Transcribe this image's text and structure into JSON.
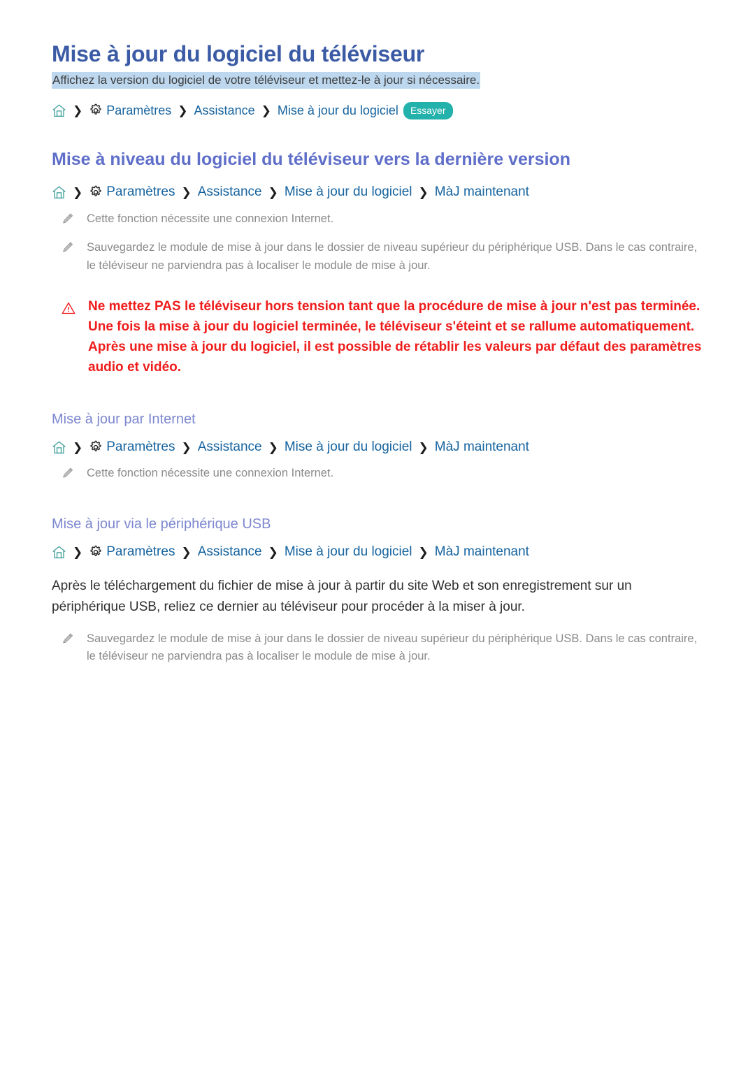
{
  "document": {
    "title": "Mise à jour du logiciel du téléviseur",
    "subtitle": "Affichez la version du logiciel de votre téléviseur et mettez-le à jour si nécessaire.",
    "try_badge_label": "Essayer"
  },
  "icons": {
    "home": "home-icon",
    "gear": "gear-icon",
    "separator": "chevron-right-icon",
    "pencil": "pencil-note-icon",
    "warning": "warning-triangle-icon"
  },
  "colors": {
    "h1": "#3b5ba5",
    "h2": "#5f6ec9",
    "h3": "#7c87cf",
    "breadcrumb_link": "#15639f",
    "highlight": "#bdd7ee",
    "badge": "#23b1ab",
    "warning": "#ef1c1c",
    "note_text": "#8a8a8a",
    "body_text": "#2f2f2f"
  },
  "breadcrumbs": {
    "top": {
      "crumbs": [
        "Paramètres",
        "Assistance",
        "Mise à jour du logiciel"
      ],
      "separator": "❯"
    },
    "upgrade": {
      "crumbs": [
        "Paramètres",
        "Assistance",
        "Mise à jour du logiciel",
        "MàJ maintenant"
      ],
      "separator": "❯"
    },
    "internet": {
      "crumbs": [
        "Paramètres",
        "Assistance",
        "Mise à jour du logiciel",
        "MàJ maintenant"
      ],
      "separator": "❯"
    },
    "usb": {
      "crumbs": [
        "Paramètres",
        "Assistance",
        "Mise à jour du logiciel",
        "MàJ maintenant"
      ],
      "separator": "❯"
    }
  },
  "sections": {
    "upgrade": {
      "heading": "Mise à niveau du logiciel du téléviseur vers la dernière version",
      "notes": [
        "Cette fonction nécessite une connexion Internet.",
        "Sauvegardez le module de mise à jour dans le dossier de niveau supérieur du périphérique USB. Dans le cas contraire, le téléviseur ne parviendra pas à localiser le module de mise à jour."
      ],
      "warning": "Ne mettez PAS le téléviseur hors tension tant que la procédure de mise à jour n'est pas terminée. Une fois la mise à jour du logiciel terminée, le téléviseur s'éteint et se rallume automatiquement. Après une mise à jour du logiciel, il est possible de rétablir les valeurs par défaut des paramètres audio et vidéo."
    },
    "internet": {
      "heading": "Mise à jour par Internet",
      "notes": [
        "Cette fonction nécessite une connexion Internet."
      ]
    },
    "usb": {
      "heading": "Mise à jour via le périphérique USB",
      "paragraph": "Après le téléchargement du fichier de mise à jour à partir du site Web et son enregistrement sur un périphérique USB, reliez ce dernier au téléviseur pour procéder à la miser à jour.",
      "notes": [
        "Sauvegardez le module de mise à jour dans le dossier de niveau supérieur du périphérique USB. Dans le cas contraire, le téléviseur ne parviendra pas à localiser le module de mise à jour."
      ]
    }
  }
}
